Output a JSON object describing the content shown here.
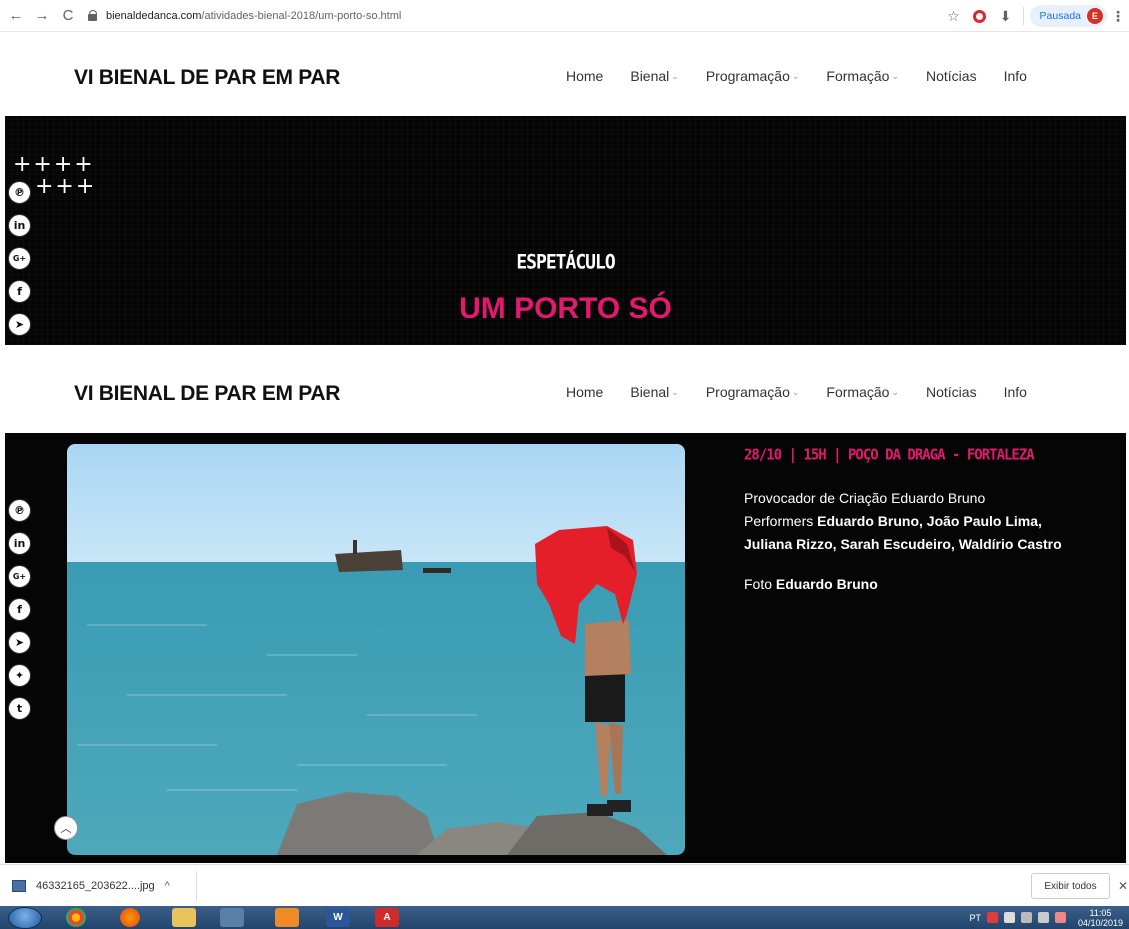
{
  "browser": {
    "url_domain": "bienaldedanca.com",
    "url_path": "/atividades-bienal-2018/um-porto-so.html",
    "profile_label": "Pausada",
    "profile_initial": "E"
  },
  "site": {
    "title": "VI BIENAL DE PAR EM PAR",
    "nav": [
      {
        "label": "Home",
        "dropdown": false
      },
      {
        "label": "Bienal",
        "dropdown": true
      },
      {
        "label": "Programação",
        "dropdown": true
      },
      {
        "label": "Formação",
        "dropdown": true
      },
      {
        "label": "Notícias",
        "dropdown": false
      },
      {
        "label": "Info",
        "dropdown": false
      }
    ]
  },
  "hero": {
    "decoration_row1": "++++",
    "decoration_row2": "+++",
    "category": "ESPETÁCULO",
    "title": "UM PORTO SÓ"
  },
  "event": {
    "date_line": "28/10 | 15H | POÇO DA DRAGA - FORTALEZA",
    "credit_role1": "Provocador de Criação",
    "credit_name1": "Eduardo Bruno",
    "credit_role2": "Performers",
    "credit_names2": "Eduardo Bruno, João Paulo Lima, Juliana Rizzo, Sarah Escudeiro, Waldírio Castro",
    "photo_role": "Foto",
    "photo_name": "Eduardo Bruno"
  },
  "share_icons_hero": [
    "pinterest-icon",
    "linkedin-icon",
    "google-plus-icon",
    "facebook-icon",
    "telegram-icon"
  ],
  "share_icons_content": [
    "pinterest-icon",
    "linkedin-icon",
    "google-plus-icon",
    "facebook-icon",
    "telegram-icon",
    "twitter-icon",
    "tumblr-icon"
  ],
  "download": {
    "filename": "46332165_203622....jpg",
    "show_all_label": "Exibir todos"
  },
  "taskbar": {
    "lang": "PT",
    "time": "11:05",
    "date": "04/10/2019"
  },
  "colors": {
    "accent": "#e3186f",
    "background_dark": "#050505"
  }
}
